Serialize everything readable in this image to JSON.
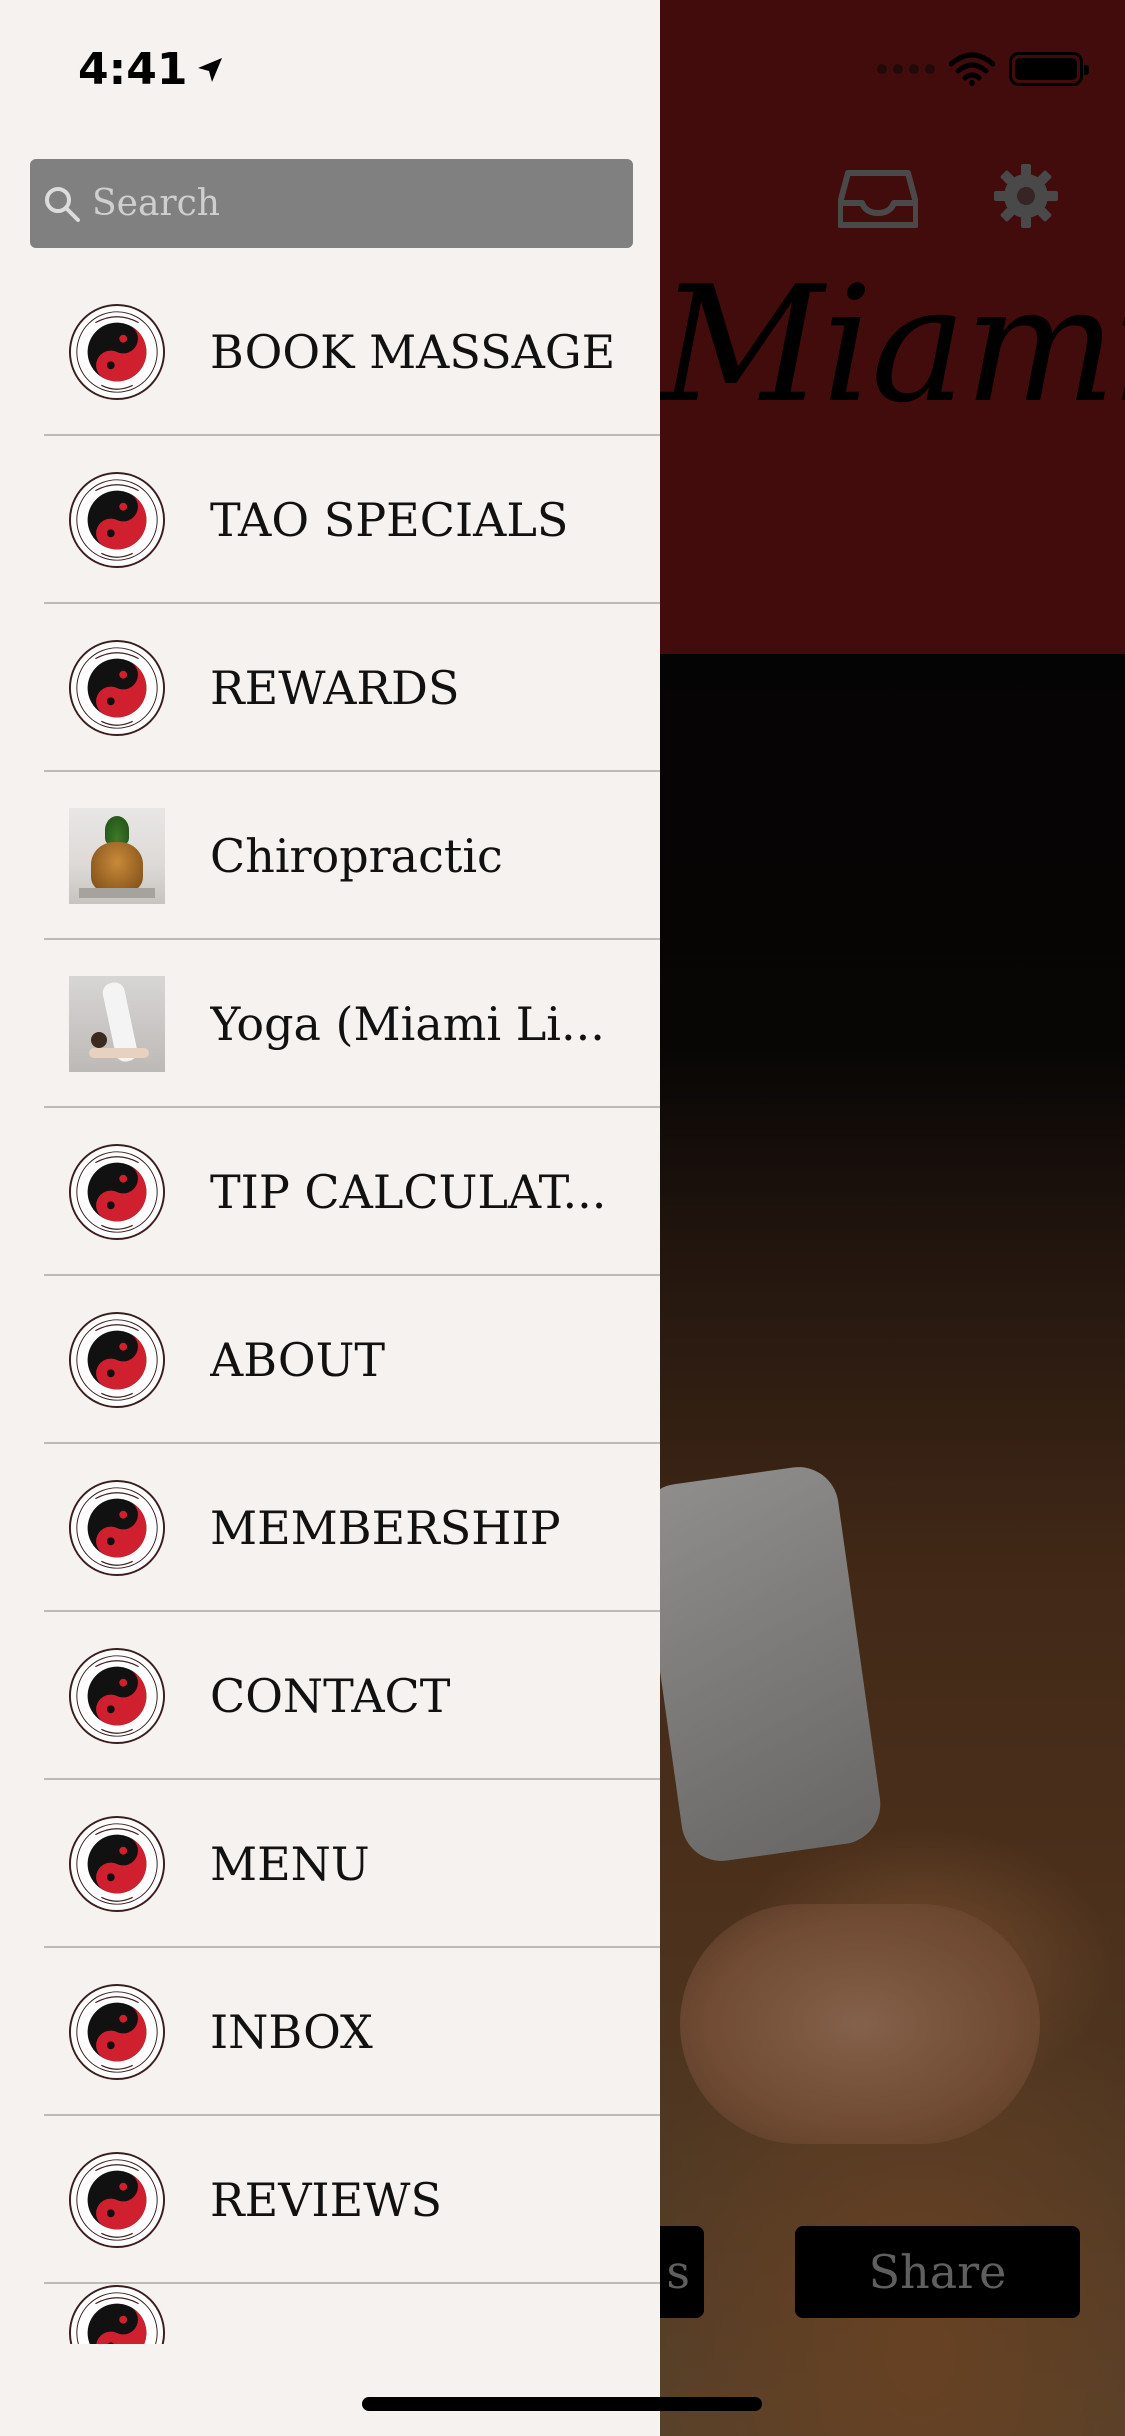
{
  "status_bar": {
    "time": "4:41"
  },
  "search": {
    "placeholder": "Search"
  },
  "menu": {
    "items": [
      {
        "label": "BOOK MASSAGE",
        "thumb": "tao-spa-logo"
      },
      {
        "label": "TAO SPECIALS",
        "thumb": "tao-spa-logo"
      },
      {
        "label": "REWARDS",
        "thumb": "tao-spa-logo"
      },
      {
        "label": "Chiropractic",
        "thumb": "buddha-statue-photo"
      },
      {
        "label": "Yoga (Miami Li...",
        "thumb": "yoga-pose-photo"
      },
      {
        "label": "TIP CALCULAT...",
        "thumb": "tao-spa-logo"
      },
      {
        "label": "ABOUT",
        "thumb": "tao-spa-logo"
      },
      {
        "label": "MEMBERSHIP",
        "thumb": "tao-spa-logo"
      },
      {
        "label": "CONTACT",
        "thumb": "tao-spa-logo"
      },
      {
        "label": "MENU",
        "thumb": "tao-spa-logo"
      },
      {
        "label": "INBOX",
        "thumb": "tao-spa-logo"
      },
      {
        "label": "REVIEWS",
        "thumb": "tao-spa-logo"
      }
    ]
  },
  "logo": {
    "text_top": "Tao Spa Miami",
    "text_bottom": "Day Spa"
  },
  "app": {
    "brand_text": "Miami",
    "left_button_label": "s",
    "share_button_label": "Share"
  },
  "colors": {
    "drawer_bg": "#f5f2f0",
    "header_red": "#6b1414",
    "search_bg": "#808080",
    "logo_red": "#d01f2e"
  }
}
